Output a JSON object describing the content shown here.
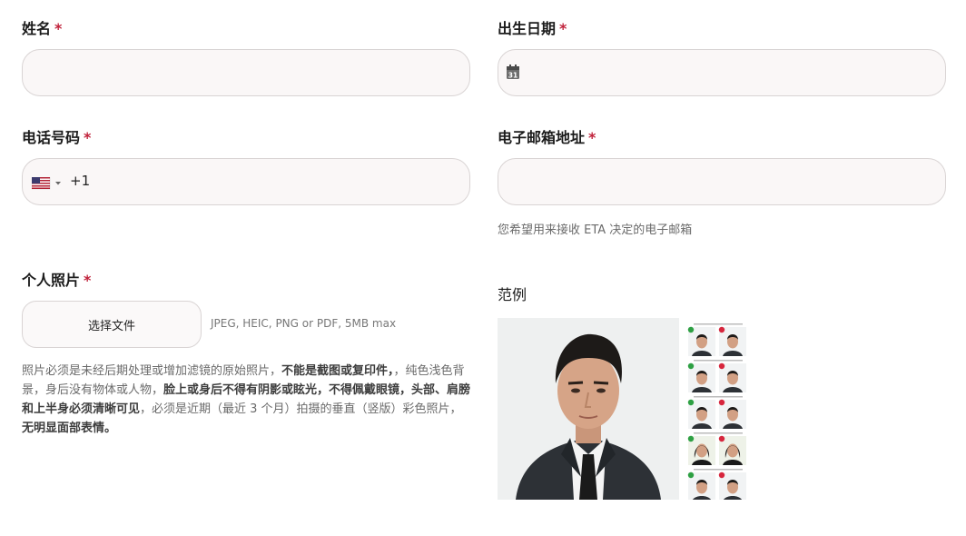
{
  "form": {
    "name": {
      "label": "姓名",
      "required_mark": "*",
      "value": ""
    },
    "dob": {
      "label": "出生日期",
      "required_mark": "*",
      "value": "",
      "icon": "calendar-icon",
      "icon_day": "31"
    },
    "phone": {
      "label": "电话号码",
      "required_mark": "*",
      "country_flag": "us-flag-icon",
      "dial_code": "+1",
      "value": ""
    },
    "email": {
      "label": "电子邮箱地址",
      "required_mark": "*",
      "value": "",
      "hint": "您希望用来接收 ETA 决定的电子邮箱"
    },
    "photo": {
      "label": "个人照片",
      "required_mark": "*",
      "choose_button": "选择文件",
      "file_note": "JPEG, HEIC, PNG or PDF, 5MB max",
      "desc_1": "照片必须是未经后期处理或增加滤镜的原始照片，",
      "desc_2": "不能是截图或复印件，",
      "desc_3": "，纯色浅色背景，身后没有物体或人物，",
      "desc_4": "脸上或身后不得有阴影或眩光，",
      "desc_5": "不得佩戴眼镜，头部、肩膀和上半身必须清晰可见",
      "desc_6": "，必须是近期（最近 3 个月）拍摄的垂直（竖版）彩色照片，",
      "desc_7": "无明显面部表情。"
    },
    "example": {
      "label": "范例"
    }
  },
  "colors": {
    "required": "#c0213a",
    "field_bg": "#faf7f7",
    "field_border": "#d9d4d4",
    "ok": "#2ea043",
    "bad": "#d7263d"
  }
}
